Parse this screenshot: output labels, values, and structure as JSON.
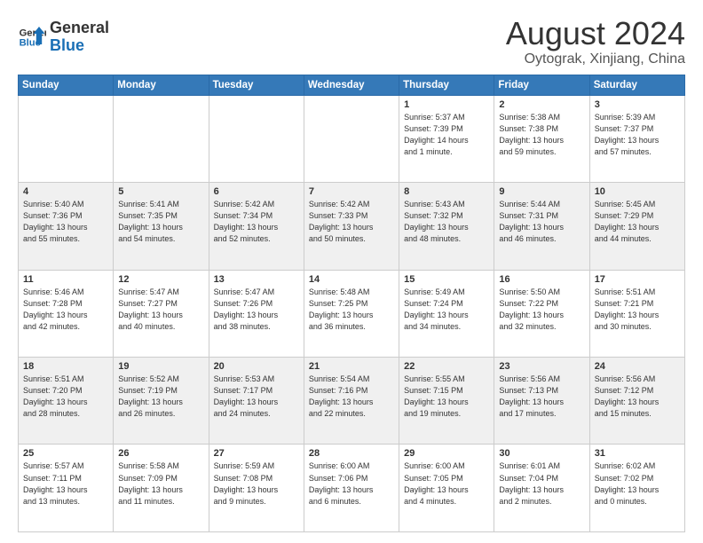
{
  "header": {
    "logo_line1": "General",
    "logo_line2": "Blue",
    "month_year": "August 2024",
    "location": "Oytograk, Xinjiang, China"
  },
  "weekdays": [
    "Sunday",
    "Monday",
    "Tuesday",
    "Wednesday",
    "Thursday",
    "Friday",
    "Saturday"
  ],
  "weeks": [
    [
      {
        "day": "",
        "info": ""
      },
      {
        "day": "",
        "info": ""
      },
      {
        "day": "",
        "info": ""
      },
      {
        "day": "",
        "info": ""
      },
      {
        "day": "1",
        "info": "Sunrise: 5:37 AM\nSunset: 7:39 PM\nDaylight: 14 hours\nand 1 minute."
      },
      {
        "day": "2",
        "info": "Sunrise: 5:38 AM\nSunset: 7:38 PM\nDaylight: 13 hours\nand 59 minutes."
      },
      {
        "day": "3",
        "info": "Sunrise: 5:39 AM\nSunset: 7:37 PM\nDaylight: 13 hours\nand 57 minutes."
      }
    ],
    [
      {
        "day": "4",
        "info": "Sunrise: 5:40 AM\nSunset: 7:36 PM\nDaylight: 13 hours\nand 55 minutes."
      },
      {
        "day": "5",
        "info": "Sunrise: 5:41 AM\nSunset: 7:35 PM\nDaylight: 13 hours\nand 54 minutes."
      },
      {
        "day": "6",
        "info": "Sunrise: 5:42 AM\nSunset: 7:34 PM\nDaylight: 13 hours\nand 52 minutes."
      },
      {
        "day": "7",
        "info": "Sunrise: 5:42 AM\nSunset: 7:33 PM\nDaylight: 13 hours\nand 50 minutes."
      },
      {
        "day": "8",
        "info": "Sunrise: 5:43 AM\nSunset: 7:32 PM\nDaylight: 13 hours\nand 48 minutes."
      },
      {
        "day": "9",
        "info": "Sunrise: 5:44 AM\nSunset: 7:31 PM\nDaylight: 13 hours\nand 46 minutes."
      },
      {
        "day": "10",
        "info": "Sunrise: 5:45 AM\nSunset: 7:29 PM\nDaylight: 13 hours\nand 44 minutes."
      }
    ],
    [
      {
        "day": "11",
        "info": "Sunrise: 5:46 AM\nSunset: 7:28 PM\nDaylight: 13 hours\nand 42 minutes."
      },
      {
        "day": "12",
        "info": "Sunrise: 5:47 AM\nSunset: 7:27 PM\nDaylight: 13 hours\nand 40 minutes."
      },
      {
        "day": "13",
        "info": "Sunrise: 5:47 AM\nSunset: 7:26 PM\nDaylight: 13 hours\nand 38 minutes."
      },
      {
        "day": "14",
        "info": "Sunrise: 5:48 AM\nSunset: 7:25 PM\nDaylight: 13 hours\nand 36 minutes."
      },
      {
        "day": "15",
        "info": "Sunrise: 5:49 AM\nSunset: 7:24 PM\nDaylight: 13 hours\nand 34 minutes."
      },
      {
        "day": "16",
        "info": "Sunrise: 5:50 AM\nSunset: 7:22 PM\nDaylight: 13 hours\nand 32 minutes."
      },
      {
        "day": "17",
        "info": "Sunrise: 5:51 AM\nSunset: 7:21 PM\nDaylight: 13 hours\nand 30 minutes."
      }
    ],
    [
      {
        "day": "18",
        "info": "Sunrise: 5:51 AM\nSunset: 7:20 PM\nDaylight: 13 hours\nand 28 minutes."
      },
      {
        "day": "19",
        "info": "Sunrise: 5:52 AM\nSunset: 7:19 PM\nDaylight: 13 hours\nand 26 minutes."
      },
      {
        "day": "20",
        "info": "Sunrise: 5:53 AM\nSunset: 7:17 PM\nDaylight: 13 hours\nand 24 minutes."
      },
      {
        "day": "21",
        "info": "Sunrise: 5:54 AM\nSunset: 7:16 PM\nDaylight: 13 hours\nand 22 minutes."
      },
      {
        "day": "22",
        "info": "Sunrise: 5:55 AM\nSunset: 7:15 PM\nDaylight: 13 hours\nand 19 minutes."
      },
      {
        "day": "23",
        "info": "Sunrise: 5:56 AM\nSunset: 7:13 PM\nDaylight: 13 hours\nand 17 minutes."
      },
      {
        "day": "24",
        "info": "Sunrise: 5:56 AM\nSunset: 7:12 PM\nDaylight: 13 hours\nand 15 minutes."
      }
    ],
    [
      {
        "day": "25",
        "info": "Sunrise: 5:57 AM\nSunset: 7:11 PM\nDaylight: 13 hours\nand 13 minutes."
      },
      {
        "day": "26",
        "info": "Sunrise: 5:58 AM\nSunset: 7:09 PM\nDaylight: 13 hours\nand 11 minutes."
      },
      {
        "day": "27",
        "info": "Sunrise: 5:59 AM\nSunset: 7:08 PM\nDaylight: 13 hours\nand 9 minutes."
      },
      {
        "day": "28",
        "info": "Sunrise: 6:00 AM\nSunset: 7:06 PM\nDaylight: 13 hours\nand 6 minutes."
      },
      {
        "day": "29",
        "info": "Sunrise: 6:00 AM\nSunset: 7:05 PM\nDaylight: 13 hours\nand 4 minutes."
      },
      {
        "day": "30",
        "info": "Sunrise: 6:01 AM\nSunset: 7:04 PM\nDaylight: 13 hours\nand 2 minutes."
      },
      {
        "day": "31",
        "info": "Sunrise: 6:02 AM\nSunset: 7:02 PM\nDaylight: 13 hours\nand 0 minutes."
      }
    ]
  ]
}
